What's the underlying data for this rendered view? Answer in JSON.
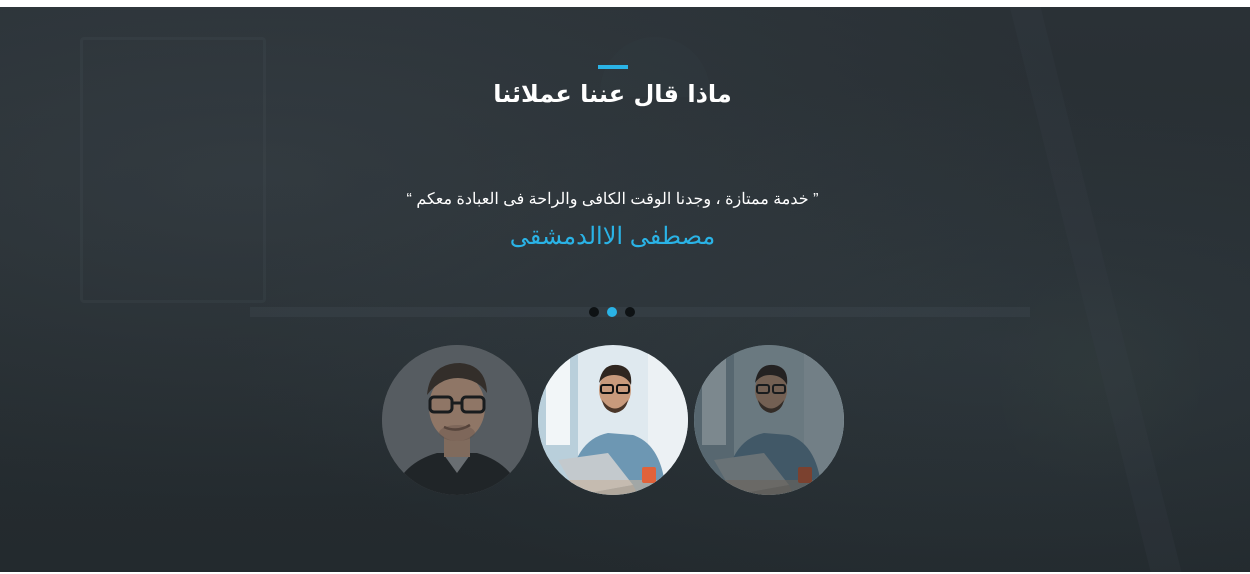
{
  "testimonials": {
    "title": "ماذا قال عننا عملائنا",
    "quote": "” خدمة ممتازة ، وجدنا الوقت الكافى والراحة فى العبادة معكم “",
    "author": "مصطفى اﻻالدمشقى",
    "accent_color": "#2ab3e6",
    "dots": [
      {
        "active": false
      },
      {
        "active": true
      },
      {
        "active": false
      }
    ],
    "slide_count": 3,
    "active_slide": 2,
    "avatars": [
      {
        "name": "client-photo-glasses-man",
        "active": false
      },
      {
        "name": "client-photo-laptop-man",
        "active": true
      },
      {
        "name": "client-photo-laptop-man-alt",
        "active": false
      }
    ]
  }
}
